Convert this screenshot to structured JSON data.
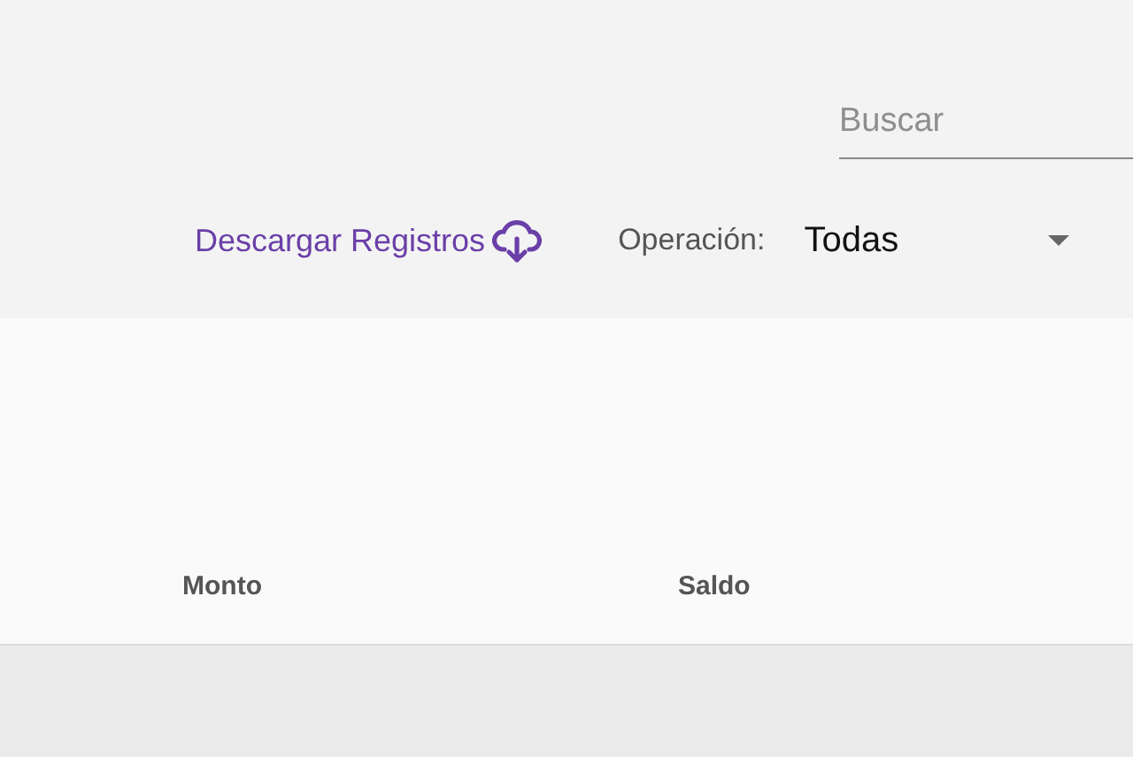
{
  "search": {
    "placeholder": "Buscar"
  },
  "download_link": {
    "label": "Descargar Registros"
  },
  "operation_filter": {
    "label": "Operación:",
    "value": "Todas"
  },
  "table": {
    "columns": [
      "Monto",
      "Saldo"
    ]
  }
}
